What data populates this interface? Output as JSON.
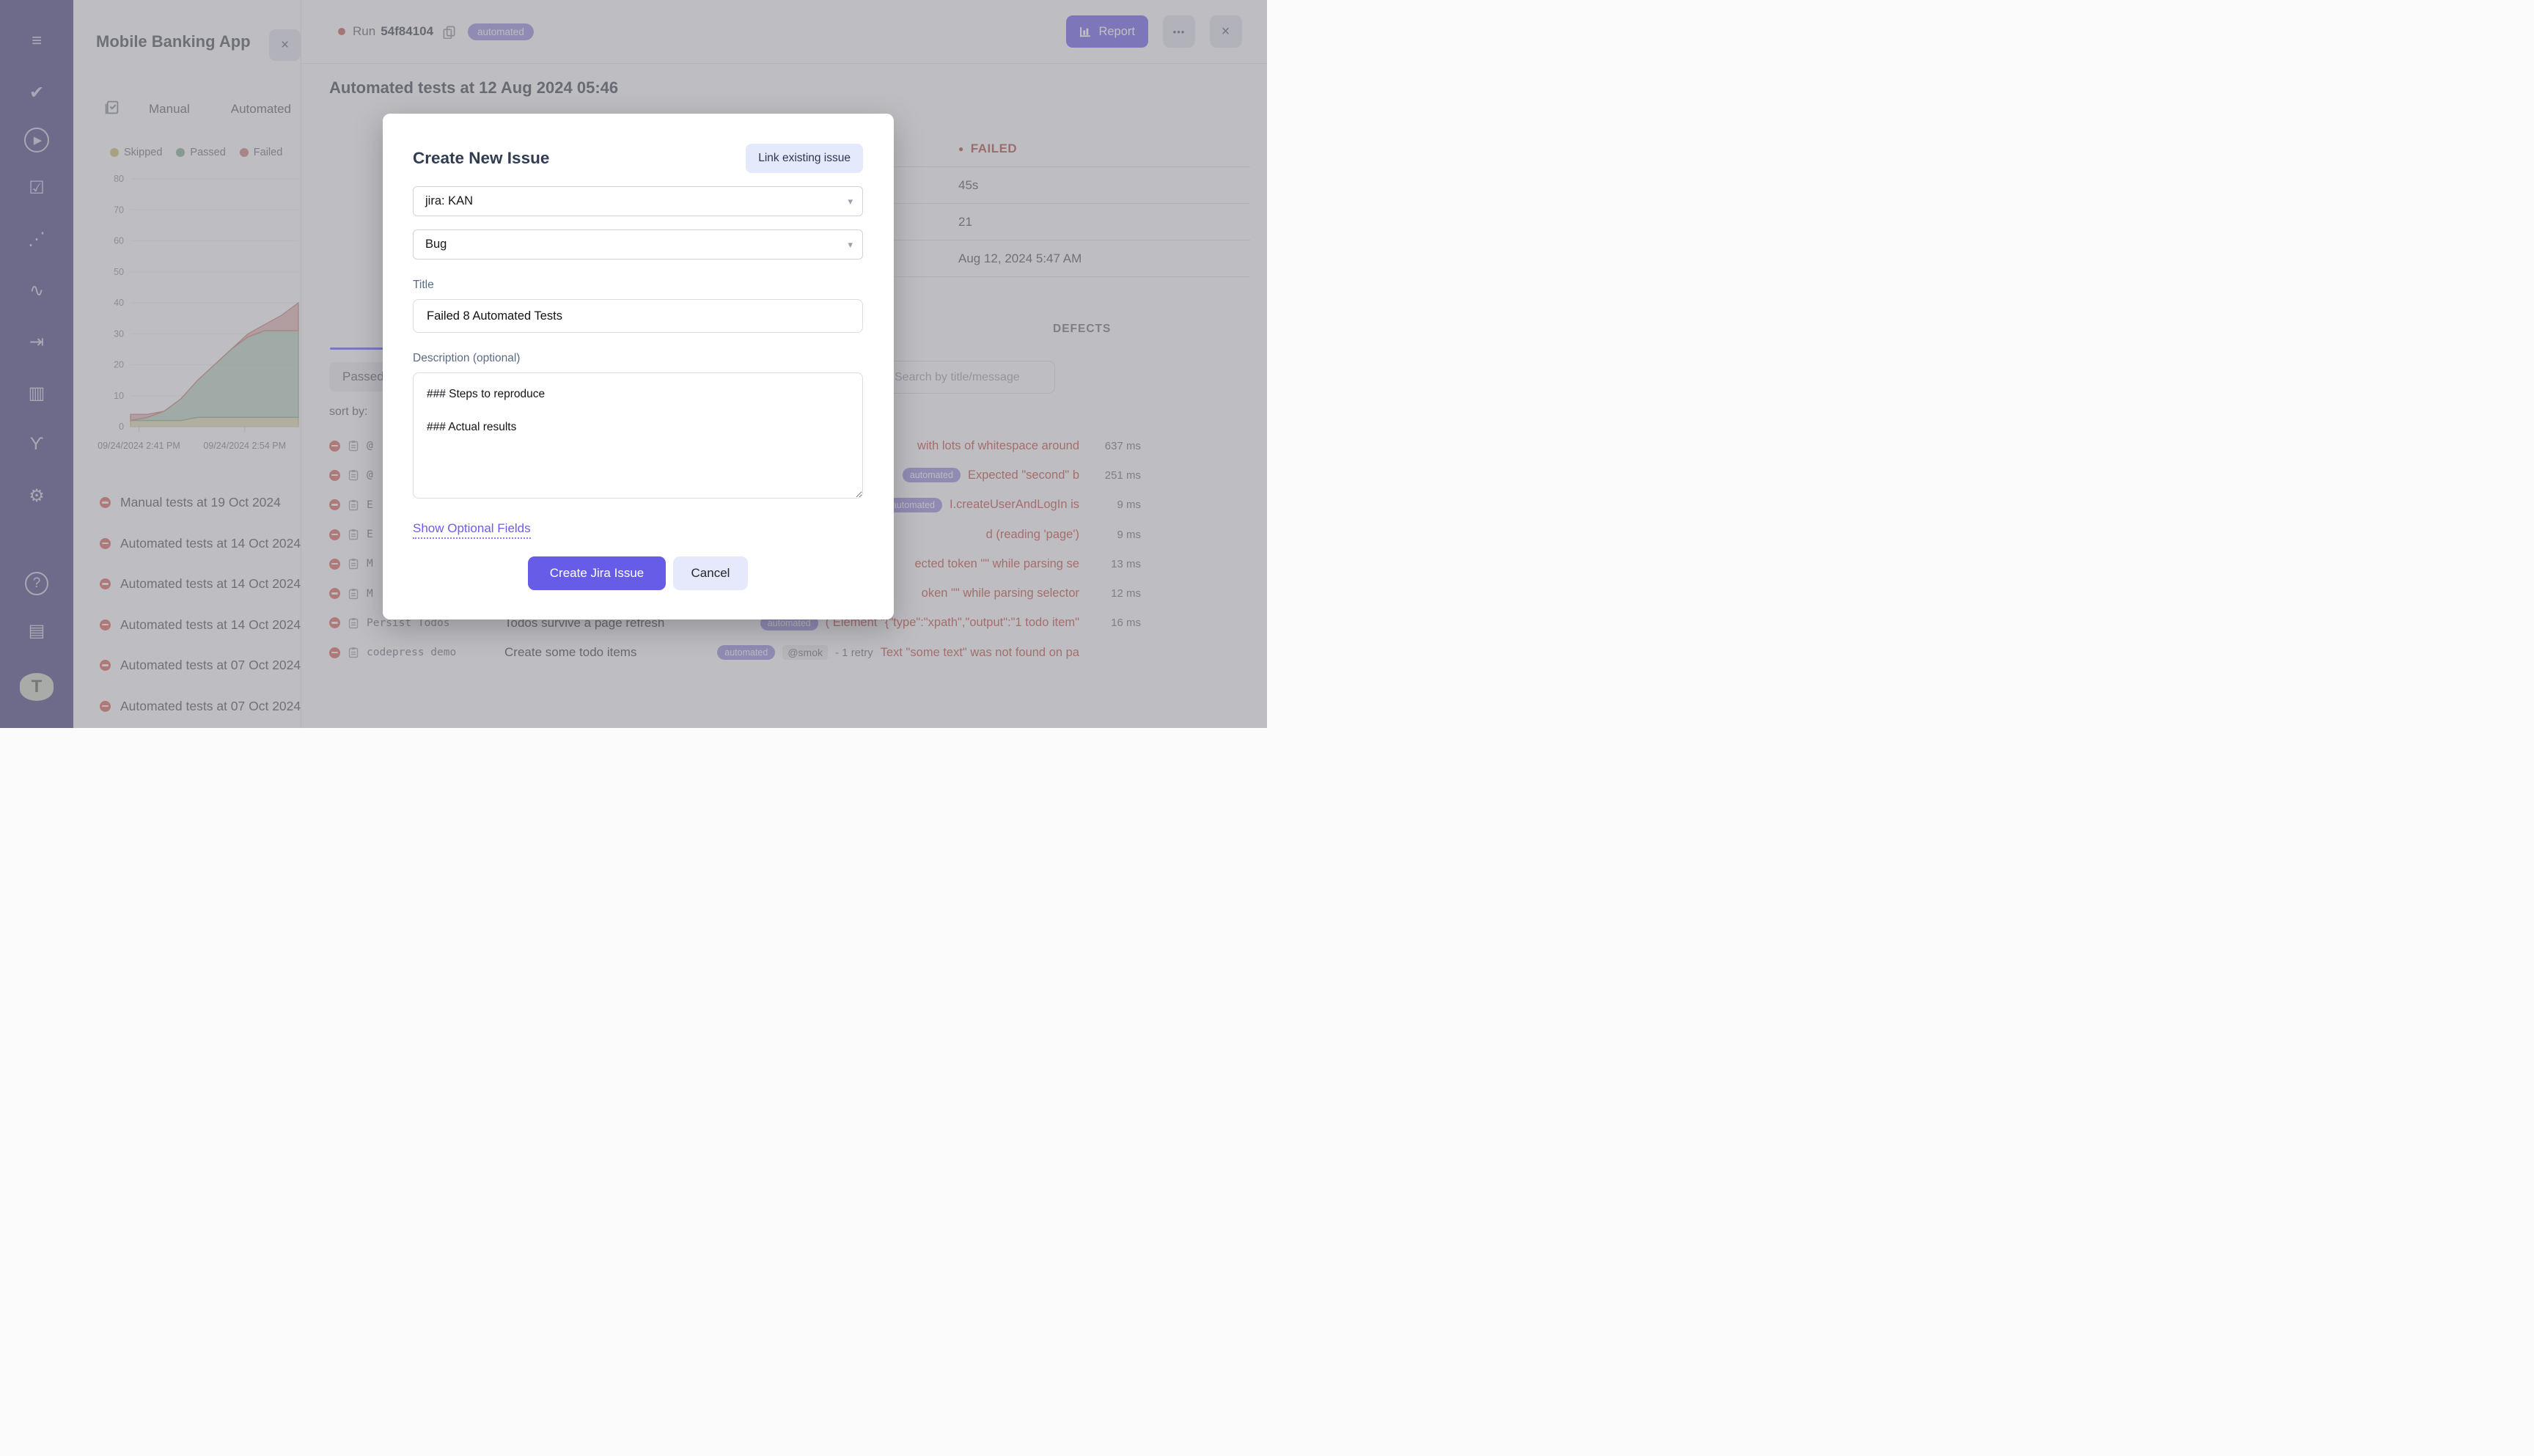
{
  "app": {
    "accent": "#6c5ce7"
  },
  "sidebar": {
    "items": [
      {
        "name": "menu-icon",
        "glyph": "≡"
      },
      {
        "name": "tests-icon",
        "glyph": "✔"
      },
      {
        "name": "runs-play-icon",
        "glyph": "▶"
      },
      {
        "name": "test-plans-icon",
        "glyph": "☑"
      },
      {
        "name": "steps-icon",
        "glyph": "⋰"
      },
      {
        "name": "pulse-icon",
        "glyph": "∿"
      },
      {
        "name": "import-icon",
        "glyph": "⇥"
      },
      {
        "name": "analytics-icon",
        "glyph": "▥"
      },
      {
        "name": "branches-icon",
        "glyph": "ϒ"
      },
      {
        "name": "settings-gear-icon",
        "glyph": "⚙"
      },
      {
        "name": "help-icon",
        "glyph": "?"
      },
      {
        "name": "projects-folder-icon",
        "glyph": "▤"
      },
      {
        "name": "logo-icon",
        "glyph": "T"
      }
    ]
  },
  "project_panel": {
    "title": "Mobile Banking App",
    "close_label": "×",
    "tabs": [
      {
        "label": "Manual"
      },
      {
        "label": "Automated"
      }
    ],
    "runs": [
      {
        "label": "Manual tests at 19 Oct 2024"
      },
      {
        "label": "Automated tests at 14 Oct 2024"
      },
      {
        "label": "Automated tests at 14 Oct 2024"
      },
      {
        "label": "Automated tests at 14 Oct 2024"
      },
      {
        "label": "Automated tests at 07 Oct 2024"
      },
      {
        "label": "Automated tests at 07 Oct 2024"
      }
    ]
  },
  "chart_data": {
    "type": "area",
    "stacked": true,
    "title": "",
    "x_labels": [
      "09/24/2024 2:41 PM",
      "09/24/2024 2:54 PM"
    ],
    "x_label_positions": [
      0.05,
      0.68
    ],
    "y_ticks": [
      0,
      10,
      20,
      30,
      40,
      50,
      60,
      70,
      80
    ],
    "ylim": [
      0,
      80
    ],
    "legend_position": "top",
    "grid": true,
    "series": [
      {
        "name": "Skipped",
        "color": "#c9bd6f",
        "values": [
          2,
          2,
          2,
          2,
          3,
          3,
          3,
          3,
          3,
          3,
          3
        ]
      },
      {
        "name": "Passed",
        "color": "#84ab8e",
        "values": [
          0,
          1,
          3,
          7,
          12,
          17,
          22,
          26,
          28,
          28,
          28
        ]
      },
      {
        "name": "Failed",
        "color": "#c97a74",
        "values": [
          2,
          1,
          0,
          0,
          0,
          0,
          0,
          1,
          2,
          5,
          9
        ]
      }
    ]
  },
  "run_view": {
    "run_label": "Run",
    "run_id": "54f84104",
    "badge": "automated",
    "report_label": "Report",
    "more_label": "•••",
    "close_label": "×",
    "title": "Automated tests at 12 Aug 2024 05:46",
    "info_rows": [
      {
        "dot": "●",
        "label": "FAILED"
      },
      {
        "dot": "",
        "label": "45s"
      },
      {
        "dot": "",
        "label": "21"
      },
      {
        "dot": "",
        "label": "Aug 12, 2024 5:47 AM"
      }
    ],
    "defects_heading": "DEFECTS",
    "search_placeholder": "Search by title/message",
    "passed_tab": "Passed",
    "sort_label": "sort by:",
    "rows": [
      {
        "name": "@",
        "title": "",
        "badge": "",
        "tag": "",
        "retry": "",
        "error": "with lots of whitespace around",
        "duration": "637 ms"
      },
      {
        "name": "@",
        "title": "",
        "badge": "automated",
        "tag": "",
        "retry": "",
        "error": "Expected \"second\" b",
        "duration": "251 ms"
      },
      {
        "name": "E",
        "title": "",
        "badge": "automated",
        "tag": "",
        "retry": "",
        "error": "I.createUserAndLogIn is",
        "duration": "9 ms"
      },
      {
        "name": "E",
        "title": "",
        "badge": "",
        "tag": "",
        "retry": "",
        "error": "d (reading 'page')",
        "duration": "9 ms"
      },
      {
        "name": "M",
        "title": "",
        "badge": "",
        "tag": "",
        "retry": "",
        "error": "ected token \"\" while parsing se",
        "duration": "13 ms"
      },
      {
        "name": "M",
        "title": "",
        "badge": "",
        "tag": "",
        "retry": "",
        "error": "oken \"\" while parsing selector",
        "duration": "12 ms"
      },
      {
        "name": "Persist Todos",
        "title": "Todos survive a page refresh",
        "badge": "automated",
        "tag": "",
        "retry": "",
        "error": "( Element \"{\"type\":\"xpath\",\"output\":\"1 todo item\"",
        "duration": "16 ms"
      },
      {
        "name": "codepress demo",
        "title": "Create some todo items",
        "badge": "automated",
        "tag": "@smok",
        "retry": "- 1 retry",
        "error": "Text \"some text\" was not found on pa",
        "duration": ""
      }
    ]
  },
  "modal": {
    "title": "Create New Issue",
    "link_existing_label": "Link existing issue",
    "project_select": "jira: KAN",
    "type_select": "Bug",
    "caret": "▾",
    "title_label": "Title",
    "title_value": "Failed 8 Automated Tests",
    "description_label": "Description (optional)",
    "description_value": "### Steps to reproduce\n\n### Actual results",
    "optional_fields_label": "Show Optional Fields",
    "create_label": "Create Jira Issue",
    "cancel_label": "Cancel"
  }
}
